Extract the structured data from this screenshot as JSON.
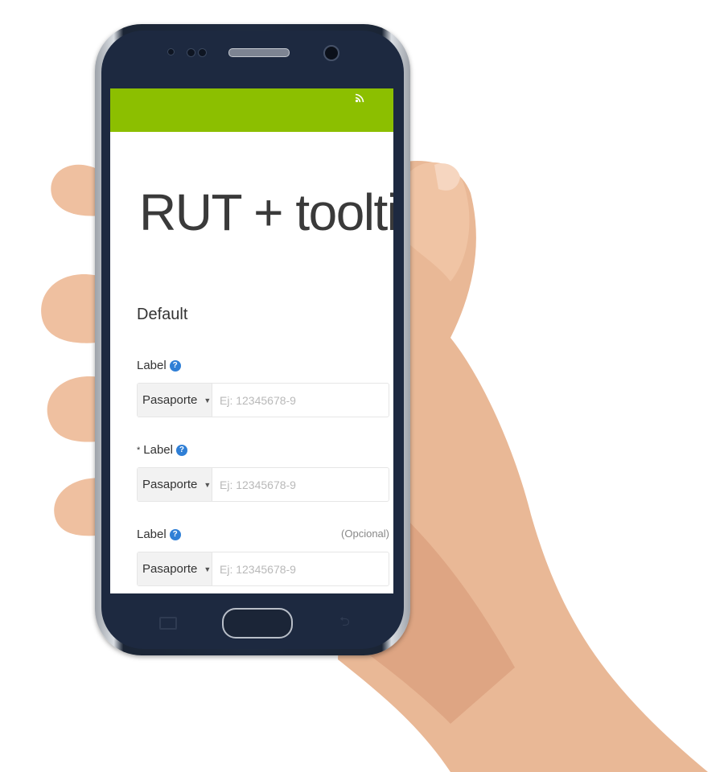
{
  "page": {
    "title": "RUT + tooltip",
    "section_title": "Default"
  },
  "fields": [
    {
      "label": "Label",
      "required_mark": "",
      "optional_text": "",
      "select_value": "Pasaporte",
      "input_value": "",
      "placeholder": "Ej: 12345678-9"
    },
    {
      "label": "Label",
      "required_mark": "*",
      "optional_text": "",
      "select_value": "Pasaporte",
      "input_value": "",
      "placeholder": "Ej: 12345678-9"
    },
    {
      "label": "Label",
      "required_mark": "",
      "optional_text": "(Opcional)",
      "select_value": "Pasaporte",
      "input_value": "",
      "placeholder": "Ej: 12345678-9"
    }
  ],
  "icons": {
    "help": "question-circle-icon",
    "status": "wifi-icon",
    "select_caret": "caret-down-icon"
  },
  "colors": {
    "topbar": "#8cbf00",
    "help_icon": "#2f7fd6",
    "phone_body": "#1d2940"
  }
}
